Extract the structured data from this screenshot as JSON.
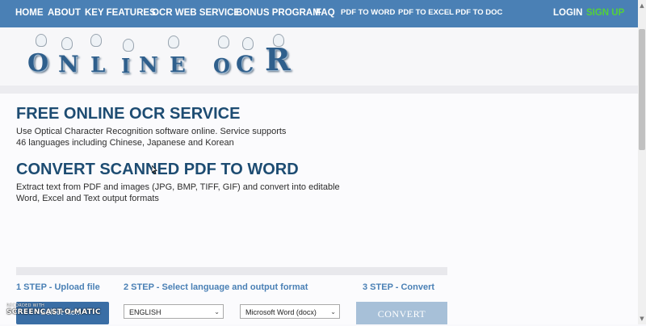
{
  "nav": {
    "items": [
      "HOME",
      "ABOUT",
      "KEY FEATURES",
      "OCR WEB SERVICE",
      "BONUS PROGRAM",
      "FAQ",
      "PDF TO WORD",
      "PDF TO EXCEL",
      "PDF TO DOC"
    ],
    "login": "LOGIN",
    "signup": "SIGN UP"
  },
  "logo": {
    "letters": [
      "O",
      "N",
      "L",
      "I",
      "N",
      "E",
      "O",
      "C",
      "R"
    ]
  },
  "intro": {
    "title": "FREE ONLINE OCR SERVICE",
    "text_line1": "Use Optical Character Recognition software online. Service supports",
    "text_line2": "46 languages including Chinese, Japanese and Korean"
  },
  "convert_section": {
    "title": "CONVERT SCANNED PDF TO WORD",
    "text_line1": "Extract text from PDF and images (JPG, BMP, TIFF, GIF) and convert into editable",
    "text_line2": "Word, Excel and Text output formats"
  },
  "steps": {
    "step1": "1 STEP - Upload file",
    "step2": "2 STEP - Select language and output format",
    "step3": "3 STEP - Convert"
  },
  "form": {
    "upload_label": "Select file...",
    "language_value": "ENGLISH",
    "format_value": "Microsoft Word (docx)",
    "convert_label": "CONVERT"
  },
  "watermark": {
    "line1": "RECORDED WITH",
    "line2": "SCREENCAST-O-MATIC"
  },
  "colors": {
    "nav_bg": "#4a80b5",
    "title": "#1d4c72",
    "signup": "#53d13a",
    "step": "#4a80b5"
  }
}
